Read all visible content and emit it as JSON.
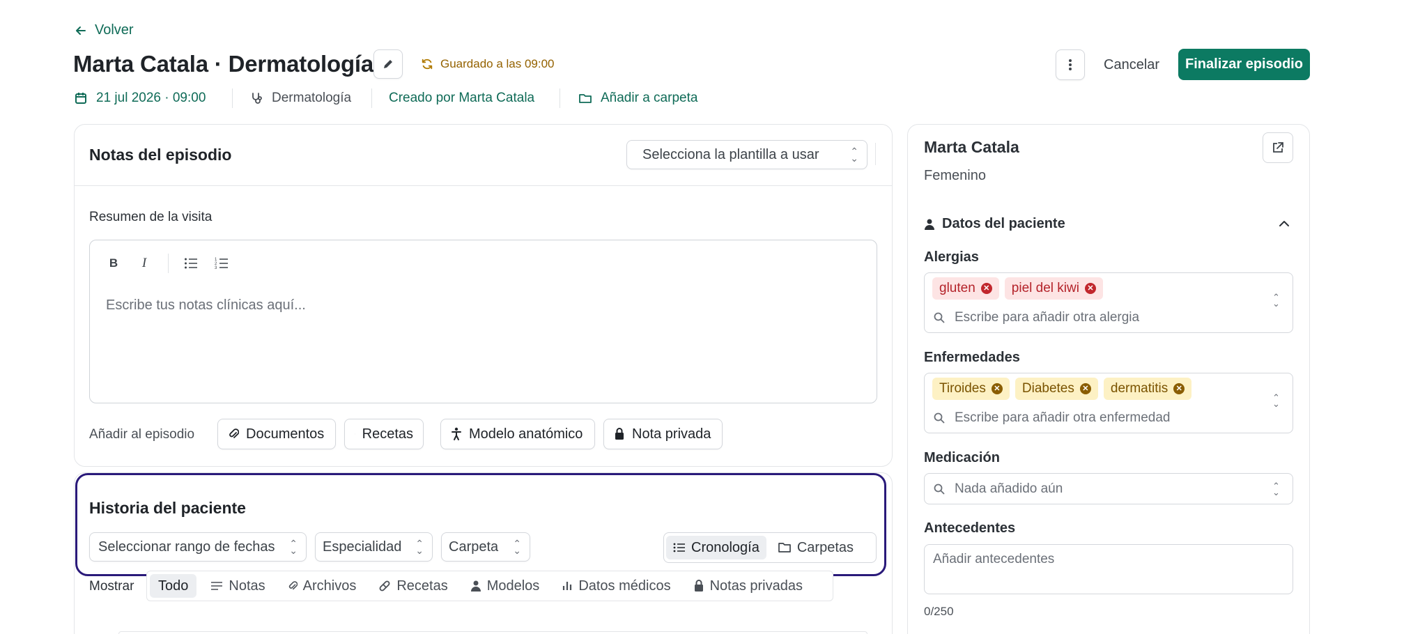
{
  "header": {
    "back_label": "Volver",
    "title": "Marta Catala · Dermatología",
    "saved_status": "Guardado a las 09:00",
    "cancel_label": "Cancelar",
    "finish_label": "Finalizar episodio"
  },
  "meta": {
    "date": "21 jul 2026 · 09:00",
    "specialty": "Dermatología",
    "created_by": "Creado por Marta Catala",
    "add_folder": "Añadir a carpeta"
  },
  "notes": {
    "title": "Notas del episodio",
    "template_placeholder": "Selecciona la plantilla a usar",
    "summary_label": "Resumen de la visita",
    "editor_placeholder": "Escribe tus notas clínicas aquí...",
    "add_label": "Añadir al episodio",
    "add_buttons": [
      "Documentos",
      "Recetas",
      "Modelo anatómico",
      "Nota privada"
    ]
  },
  "history": {
    "title": "Historia del paciente",
    "date_range": "Seleccionar rango de fechas",
    "specialty": "Especialidad",
    "folder": "Carpeta",
    "views": [
      "Cronología",
      "Carpetas"
    ],
    "show_label": "Mostrar",
    "filters": [
      "Todo",
      "Notas",
      "Archivos",
      "Recetas",
      "Modelos",
      "Datos médicos",
      "Notas privadas"
    ]
  },
  "patient": {
    "name": "Marta Catala",
    "sex": "Femenino",
    "section_title": "Datos del paciente",
    "allergies_label": "Alergias",
    "allergies": [
      "gluten",
      "piel del kiwi"
    ],
    "allergies_placeholder": "Escribe para añadir otra alergia",
    "diseases_label": "Enfermedades",
    "diseases": [
      "Tiroides",
      "Diabetes",
      "dermatitis"
    ],
    "diseases_placeholder": "Escribe para añadir otra enfermedad",
    "medication_label": "Medicación",
    "medication_placeholder": "Nada añadido aún",
    "background_label": "Antecedentes",
    "background_placeholder": "Añadir antecedentes",
    "background_count": "0/250"
  },
  "colors": {
    "accent": "#0c7a62",
    "link": "#0f6b57",
    "saved": "#946200",
    "highlight": "#2a1a7a"
  }
}
